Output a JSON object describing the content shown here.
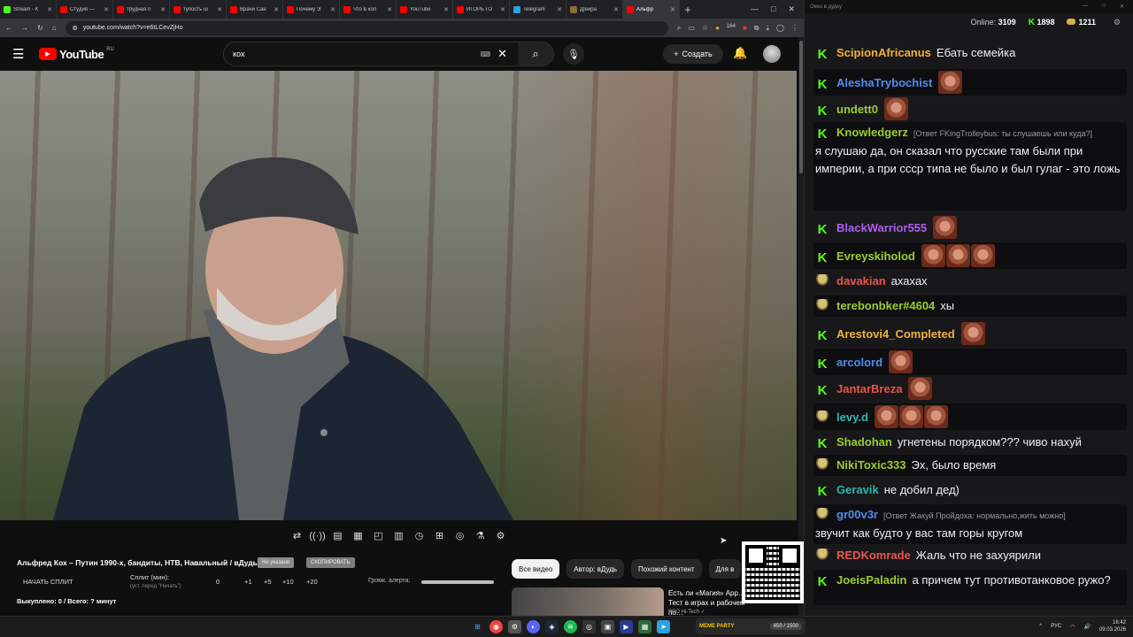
{
  "browser": {
    "tabs": [
      {
        "label": "Stream - К",
        "color": "#53fc18",
        "active": false
      },
      {
        "label": "Студия —",
        "color": "#ff0000",
        "active": false
      },
      {
        "label": "трудная п",
        "color": "#ff0000",
        "active": false
      },
      {
        "label": "тупость ш",
        "color": "#ff0000",
        "active": false
      },
      {
        "label": "Врачи Сан",
        "color": "#ff0000",
        "active": false
      },
      {
        "label": "Почему Э",
        "color": "#ff0000",
        "active": false
      },
      {
        "label": "Что в хол",
        "color": "#ff0000",
        "active": false
      },
      {
        "label": "YouTube",
        "color": "#ff0000",
        "active": false
      },
      {
        "label": "ИГОРЬ ГО",
        "color": "#ff0000",
        "active": false
      },
      {
        "label": "Telegram",
        "color": "#2aa3df",
        "active": false
      },
      {
        "label": "Д|ейра",
        "color": "#8a6d3b",
        "active": false
      },
      {
        "label": "Альфр",
        "color": "#ff0000",
        "active": true
      }
    ],
    "url": "youtube.com/watch?v=e6tLCevZjHo",
    "ext_badge": "164"
  },
  "youtube": {
    "logo_text": "YouTube",
    "region": "RU",
    "search_value": "кох",
    "create_label": "Создать"
  },
  "player_tools": [
    "⇄",
    "((·))",
    "▤",
    "▦",
    "◰",
    "▥",
    "◷",
    "⊞",
    "◎",
    "⚗",
    "⚙"
  ],
  "below": {
    "video_title": "Альфред Кох – Путин 1990-х, бандиты, НТВ, Навальный / вДудь",
    "pill_a": "Не указано",
    "pill_b": "СКОПИРОВАТЬ",
    "start_split": "НАЧАТЬ СПЛИТ",
    "split_label": "Сплит (мин):",
    "split_hint": "(уст. перед \"Начать\")",
    "split_values": [
      "0",
      "+1",
      "+5",
      "+10",
      "+20"
    ],
    "alert_label": "Громк. алерта:",
    "bought": "Выкуплено: 0 / Всего: ? минут",
    "chips": [
      "Все видео",
      "Автор: вДудь",
      "Похожий контент",
      "Для в"
    ],
    "rec_title": "Есть ли «Магия» App… Тест в играх и рабочем по…",
    "rec_meta": "PRO Hi-Tech ✓"
  },
  "chat": {
    "window_title": "Окно в дудку",
    "online_label": "Online:",
    "online_value": "3109",
    "kick_value": "1898",
    "coin_value": "1211",
    "messages": [
      {
        "badge": "k",
        "user": "ScipionAfricanus",
        "color": "#f0b13c",
        "text": "Ебать семейка",
        "reply": "",
        "emotes": 0
      },
      {
        "badge": "k",
        "user": "AleshaTrybochist",
        "color": "#4f8ef0",
        "text": "",
        "reply": "",
        "emotes": 1
      },
      {
        "badge": "k",
        "user": "undett0",
        "color": "#9acd32",
        "text": "",
        "reply": "",
        "emotes": 1
      },
      {
        "badge": "k",
        "user": "Knowledgerz",
        "color": "#9acd32",
        "text": "я слушаю да, он сказал что русские там были при империи, а при ссср типа не было и был гулаг - это ложь",
        "reply": "[Ответ FKingTrolleybus: ты слушаешь или куда?]",
        "emotes": 0
      },
      {
        "badge": "k",
        "user": "BlackWarrior555",
        "color": "#b05cf0",
        "text": "",
        "reply": "",
        "emotes": 1
      },
      {
        "badge": "k",
        "user": "Evreyskiholod",
        "color": "#9acd32",
        "text": "",
        "reply": "",
        "emotes": 3
      },
      {
        "badge": "gold",
        "user": "davakian",
        "color": "#e8554e",
        "text": "ахахах",
        "reply": "",
        "emotes": 0
      },
      {
        "badge": "gold",
        "user": "terebonbker#4604",
        "color": "#9acd32",
        "text": "хы",
        "reply": "",
        "emotes": 0
      },
      {
        "badge": "k",
        "user": "Arestovi4_Completed",
        "color": "#f0b13c",
        "text": "",
        "reply": "",
        "emotes": 1
      },
      {
        "badge": "k",
        "user": "arcolord",
        "color": "#4f8ef0",
        "text": "",
        "reply": "",
        "emotes": 1
      },
      {
        "badge": "k",
        "user": "JantarBreza",
        "color": "#e8554e",
        "text": "",
        "reply": "",
        "emotes": 1
      },
      {
        "badge": "gold",
        "user": "levy.d",
        "color": "#2db7b0",
        "text": "",
        "reply": "",
        "emotes": 3
      },
      {
        "badge": "k",
        "user": "Shadohan",
        "color": "#9acd32",
        "text": "угнетены порядком??? чиво нахуй",
        "reply": "",
        "emotes": 0
      },
      {
        "badge": "gold",
        "user": "NikiToxic333",
        "color": "#9acd32",
        "text": "Эх, было время",
        "reply": "",
        "emotes": 0
      },
      {
        "badge": "k",
        "user": "Geravik",
        "color": "#2db7b0",
        "text": "не добил дед)",
        "reply": "",
        "emotes": 0
      },
      {
        "badge": "gold",
        "user": "gr00v3r",
        "color": "#4f8ef0",
        "text": "звучит как будто у вас там горы кругом",
        "reply": "[Ответ Жакуй Пройдоха: нормально,жить можно]",
        "emotes": 0
      },
      {
        "badge": "gold",
        "user": "REDKomrade",
        "color": "#e8554e",
        "text": "Жаль что не захуярили",
        "reply": "",
        "emotes": 0
      },
      {
        "badge": "k",
        "user": "JoeisPaladin",
        "color": "#9acd32",
        "text": "а причем тут противотанковое ружо?",
        "reply": "",
        "emotes": 0
      }
    ]
  },
  "taskbar": {
    "meme_label": "MEME PARTY",
    "meme_count": "450 / 1500",
    "lang": "РУС",
    "time": "16:42",
    "date": "09.03.2026"
  }
}
